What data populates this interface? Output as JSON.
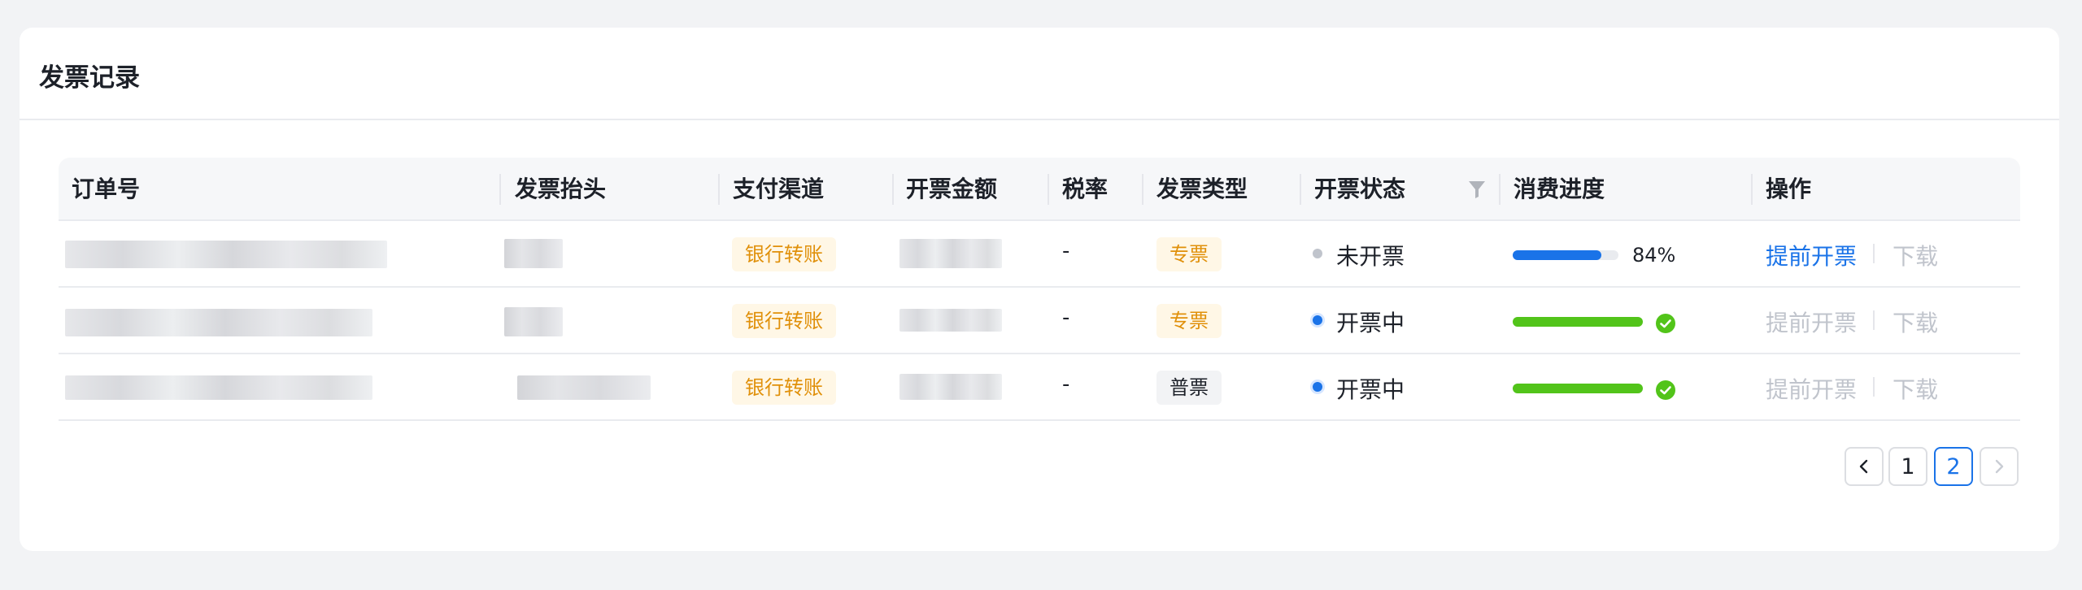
{
  "title": "发票记录",
  "columns": {
    "order_no": "订单号",
    "invoice_header": "发票抬头",
    "pay_channel": "支付渠道",
    "amount": "开票金额",
    "tax_rate": "税率",
    "invoice_type": "发票类型",
    "status": "开票状态",
    "progress": "消费进度",
    "actions": "操作"
  },
  "rows": [
    {
      "pay_channel": "银行转账",
      "tax_rate": "-",
      "invoice_type": "专票",
      "status": "未开票",
      "progress_percent": 84,
      "progress_label": "84%",
      "action_early": "提前开票",
      "action_download": "下载"
    },
    {
      "pay_channel": "银行转账",
      "tax_rate": "-",
      "invoice_type": "专票",
      "status": "开票中",
      "progress_percent": 100,
      "action_early": "提前开票",
      "action_download": "下载"
    },
    {
      "pay_channel": "银行转账",
      "tax_rate": "-",
      "invoice_type": "普票",
      "status": "开票中",
      "progress_percent": 100,
      "action_early": "提前开票",
      "action_download": "下载"
    }
  ],
  "pagination": {
    "pages": [
      "1",
      "2"
    ],
    "current": "2"
  },
  "colors": {
    "accent": "#1a73e8",
    "progress_blue": "#1a73e8",
    "progress_green": "#52c41a",
    "tag_orange": "#e0900a"
  },
  "icons": {
    "filter": "filter-icon",
    "copy": "copy-icon",
    "complete": "check-circle-icon",
    "prev": "chevron-left-icon",
    "next": "chevron-right-icon"
  }
}
